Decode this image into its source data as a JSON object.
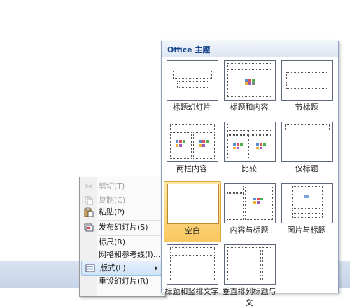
{
  "gallery": {
    "title": "Office 主题",
    "layouts": [
      {
        "label": "标题幻灯片"
      },
      {
        "label": "标题和内容"
      },
      {
        "label": "节标题"
      },
      {
        "label": "两栏内容"
      },
      {
        "label": "比较"
      },
      {
        "label": "仅标题"
      },
      {
        "label": "空白"
      },
      {
        "label": "内容与标题"
      },
      {
        "label": "图片与标题"
      },
      {
        "label": "标题和竖排文字"
      },
      {
        "label": "垂直排列标题与文"
      }
    ],
    "selected": "空白"
  },
  "context_menu": {
    "items": [
      {
        "label": "剪切(T)",
        "icon": "scissors-icon",
        "enabled": false
      },
      {
        "label": "复制(C)",
        "icon": "copy-icon",
        "enabled": false
      },
      {
        "label": "粘贴(P)",
        "icon": "paste-icon",
        "enabled": true
      },
      {
        "label": "发布幻灯片(S)",
        "icon": "publish-slides-icon",
        "enabled": true
      },
      {
        "label": "标尺(R)",
        "icon": "",
        "enabled": true
      },
      {
        "label": "网格和参考线(I)...",
        "icon": "",
        "enabled": true
      },
      {
        "label": "版式(L)",
        "icon": "layout-icon",
        "enabled": true,
        "submenu": true,
        "active": true
      },
      {
        "label": "重设幻灯片(R)",
        "icon": "",
        "enabled": true
      }
    ]
  }
}
